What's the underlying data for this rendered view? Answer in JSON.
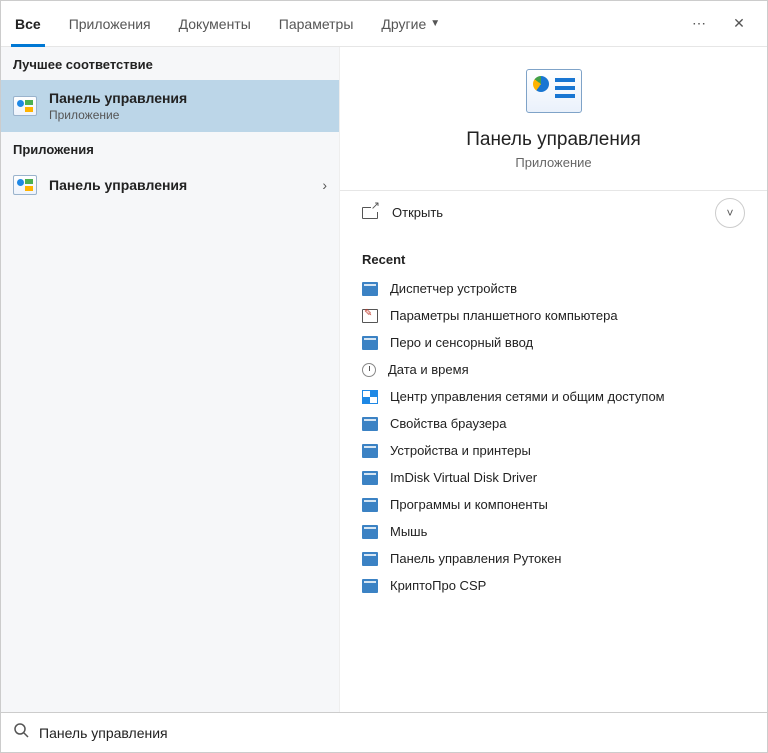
{
  "tabs": {
    "items": [
      "Все",
      "Приложения",
      "Документы",
      "Параметры",
      "Другие"
    ],
    "active_index": 0
  },
  "left": {
    "best_match_header": "Лучшее соответствие",
    "best_match": {
      "title": "Панель управления",
      "subtitle": "Приложение"
    },
    "apps_header": "Приложения",
    "apps": [
      {
        "title": "Панель управления"
      }
    ]
  },
  "preview": {
    "title": "Панель управления",
    "subtitle": "Приложение",
    "open_label": "Открыть"
  },
  "recent": {
    "header": "Recent",
    "items": [
      {
        "label": "Диспетчер устройств",
        "icon": "blue"
      },
      {
        "label": "Параметры планшетного компьютера",
        "icon": "tablet"
      },
      {
        "label": "Перо и сенсорный ввод",
        "icon": "blue"
      },
      {
        "label": "Дата и время",
        "icon": "clock"
      },
      {
        "label": "Центр управления сетями и общим доступом",
        "icon": "net"
      },
      {
        "label": "Свойства браузера",
        "icon": "blue"
      },
      {
        "label": "Устройства и принтеры",
        "icon": "blue"
      },
      {
        "label": "ImDisk Virtual Disk Driver",
        "icon": "blue"
      },
      {
        "label": "Программы и компоненты",
        "icon": "blue"
      },
      {
        "label": "Мышь",
        "icon": "blue"
      },
      {
        "label": "Панель управления Рутокен",
        "icon": "blue"
      },
      {
        "label": "КриптоПро CSP",
        "icon": "blue"
      }
    ]
  },
  "search": {
    "query": "Панель управления"
  }
}
